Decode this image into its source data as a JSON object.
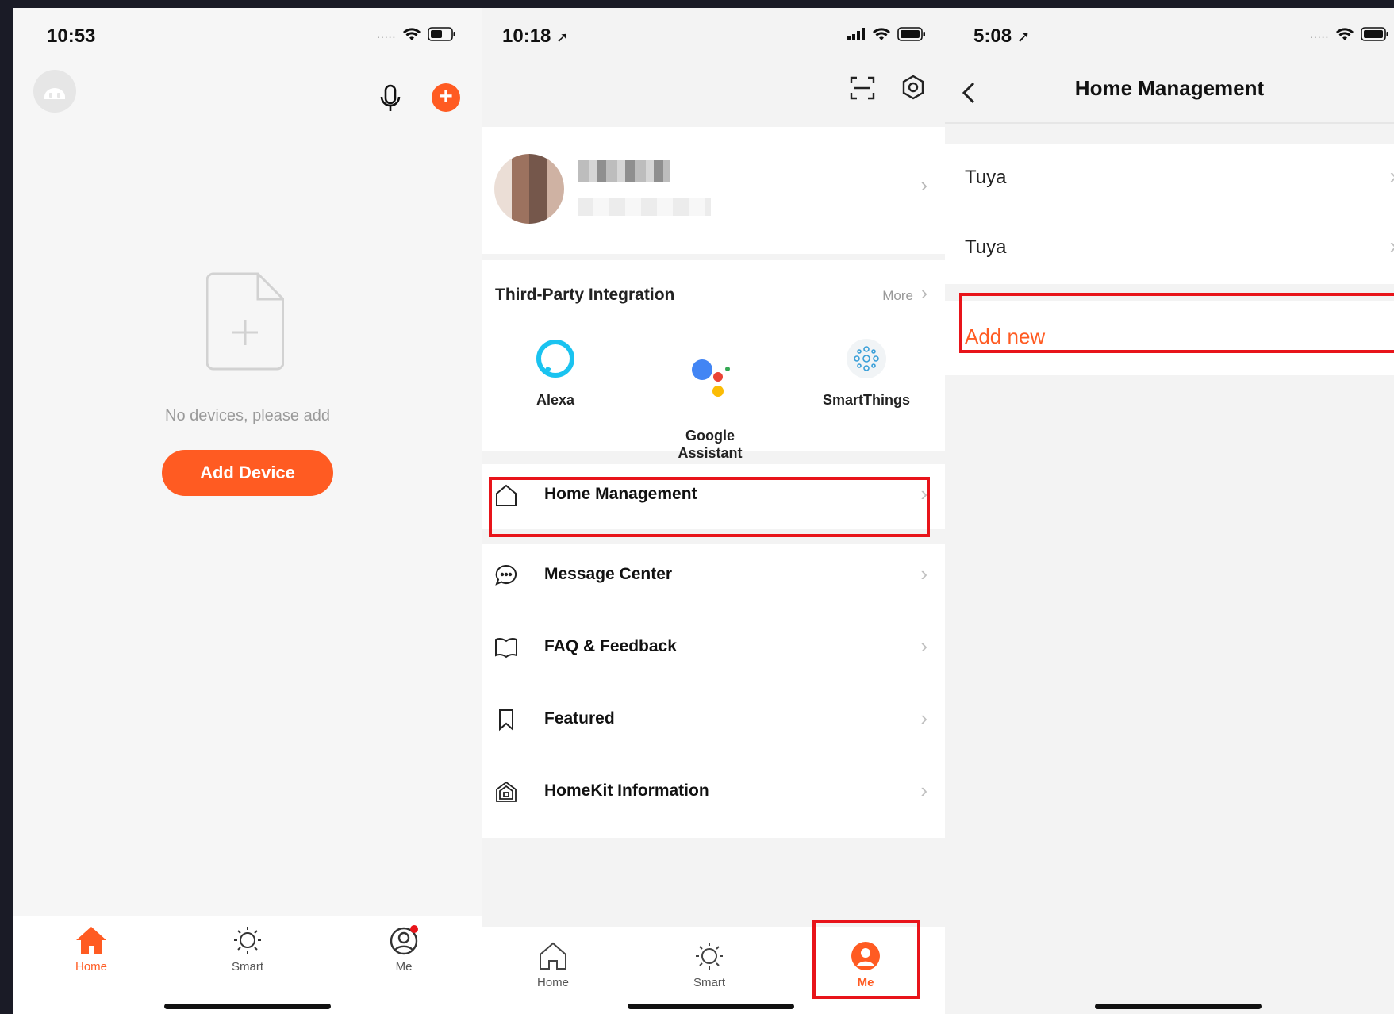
{
  "panel1": {
    "time": "10:53",
    "empty_text": "No devices, please add",
    "add_device": "Add Device",
    "tabs": [
      {
        "label": "Home",
        "icon": "home-icon"
      },
      {
        "label": "Smart",
        "icon": "sun-icon"
      },
      {
        "label": "Me",
        "icon": "user-icon"
      }
    ]
  },
  "panel2": {
    "time": "10:18",
    "third_party_title": "Third-Party Integration",
    "more": "More",
    "integrations": [
      {
        "label": "Alexa",
        "icon": "alexa-icon"
      },
      {
        "label": "Google\nAssistant",
        "icon": "google-assistant-icon"
      },
      {
        "label": "SmartThings",
        "icon": "smartthings-icon"
      }
    ],
    "menu": [
      {
        "label": "Home Management",
        "icon": "house-outline-icon"
      },
      {
        "label": "Message Center",
        "icon": "chat-bubble-icon"
      },
      {
        "label": "FAQ & Feedback",
        "icon": "book-icon"
      },
      {
        "label": "Featured",
        "icon": "bookmark-icon"
      },
      {
        "label": "HomeKit Information",
        "icon": "homekit-icon"
      }
    ],
    "tabs": [
      {
        "label": "Home",
        "icon": "home-outline-icon"
      },
      {
        "label": "Smart",
        "icon": "sun-icon"
      },
      {
        "label": "Me",
        "icon": "user-filled-icon"
      }
    ]
  },
  "panel3": {
    "time": "5:08",
    "title": "Home Management",
    "homes": [
      "Tuya",
      "Tuya"
    ],
    "add_new": "Add new"
  },
  "colors": {
    "accent": "#ff5b22",
    "highlight": "#e8141a",
    "background": "#1a1b26"
  }
}
